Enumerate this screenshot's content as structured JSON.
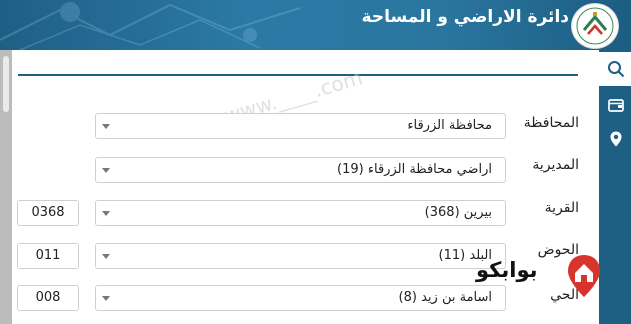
{
  "header": {
    "title": "دائرة الاراضي و المساحة"
  },
  "watermark": "© www.____.com",
  "form": {
    "governorate": {
      "label": "المحافظة",
      "value": "محافظة الزرقاء"
    },
    "directorate": {
      "label": "المديرية",
      "value": "اراضي محافظة الزرقاء (19)"
    },
    "village": {
      "label": "القرية",
      "value": "بيرين (368)",
      "code": "0368"
    },
    "basin": {
      "label": "الحوض",
      "value": "البلد (11)",
      "code": "011"
    },
    "neighborhood": {
      "label": "الحي",
      "value": "اسامة بن زيد (8)",
      "code": "008"
    }
  },
  "brand": {
    "name": "بوابكو"
  },
  "icons": [
    "search-icon",
    "wallet-icon",
    "location-pin-icon"
  ],
  "colors": {
    "header": "#2b7aa6",
    "rail": "#1e5f84",
    "brand_red": "#d8342b"
  }
}
